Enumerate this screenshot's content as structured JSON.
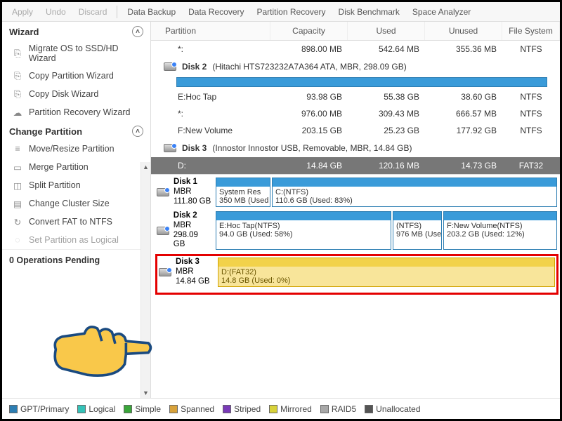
{
  "toolbar": {
    "apply": "Apply",
    "undo": "Undo",
    "discard": "Discard",
    "data_backup": "Data Backup",
    "data_recovery": "Data Recovery",
    "partition_recovery": "Partition Recovery",
    "disk_benchmark": "Disk Benchmark",
    "space_analyzer": "Space Analyzer"
  },
  "sidebar": {
    "wizard_head": "Wizard",
    "wizard": [
      "Migrate OS to SSD/HD Wizard",
      "Copy Partition Wizard",
      "Copy Disk Wizard",
      "Partition Recovery Wizard"
    ],
    "change_head": "Change Partition",
    "change": [
      "Move/Resize Partition",
      "Merge Partition",
      "Split Partition",
      "Change Cluster Size",
      "Convert FAT to NTFS",
      "Set Partition as Logical"
    ],
    "pending": "0 Operations Pending"
  },
  "table": {
    "headers": [
      "Partition",
      "Capacity",
      "Used",
      "Unused",
      "File System"
    ],
    "r0": {
      "name": "*:",
      "cap": "898.00 MB",
      "used": "542.64 MB",
      "unused": "355.36 MB",
      "fs": "NTFS"
    },
    "disk2_head": "Disk 2",
    "disk2_sub": "(Hitachi HTS723232A7A364 ATA, MBR, 298.09 GB)",
    "r1": {
      "name": "E:Hoc Tap",
      "cap": "93.98 GB",
      "used": "55.38 GB",
      "unused": "38.60 GB",
      "fs": "NTFS"
    },
    "r2": {
      "name": "*:",
      "cap": "976.00 MB",
      "used": "309.43 MB",
      "unused": "666.57 MB",
      "fs": "NTFS"
    },
    "r3": {
      "name": "F:New Volume",
      "cap": "203.15 GB",
      "used": "25.23 GB",
      "unused": "177.92 GB",
      "fs": "NTFS"
    },
    "disk3_head": "Disk 3",
    "disk3_sub": "(Innostor Innostor USB, Removable, MBR, 14.84 GB)",
    "r4": {
      "name": "D:",
      "cap": "14.84 GB",
      "used": "120.16 MB",
      "unused": "14.73 GB",
      "fs": "FAT32"
    }
  },
  "diskview": {
    "d1": {
      "name": "Disk 1",
      "type": "MBR",
      "size": "111.80 GB",
      "p1": {
        "title": "System Res",
        "sub": "350 MB (Used"
      },
      "p2": {
        "title": "C:(NTFS)",
        "sub": "110.6 GB (Used: 83%)"
      }
    },
    "d2": {
      "name": "Disk 2",
      "type": "MBR",
      "size": "298.09 GB",
      "p1": {
        "title": "E:Hoc Tap(NTFS)",
        "sub": "94.0 GB (Used: 58%)"
      },
      "p2": {
        "title": "(NTFS)",
        "sub": "976 MB (Use"
      },
      "p3": {
        "title": "F:New Volume(NTFS)",
        "sub": "203.2 GB (Used: 12%)"
      }
    },
    "d3": {
      "name": "Disk 3",
      "type": "MBR",
      "size": "14.84 GB",
      "p1": {
        "title": "D:(FAT32)",
        "sub": "14.8 GB (Used: 0%)"
      }
    }
  },
  "legend": {
    "gpt": "GPT/Primary",
    "logical": "Logical",
    "simple": "Simple",
    "spanned": "Spanned",
    "striped": "Striped",
    "mirrored": "Mirrored",
    "raid5": "RAID5",
    "unalloc": "Unallocated"
  }
}
